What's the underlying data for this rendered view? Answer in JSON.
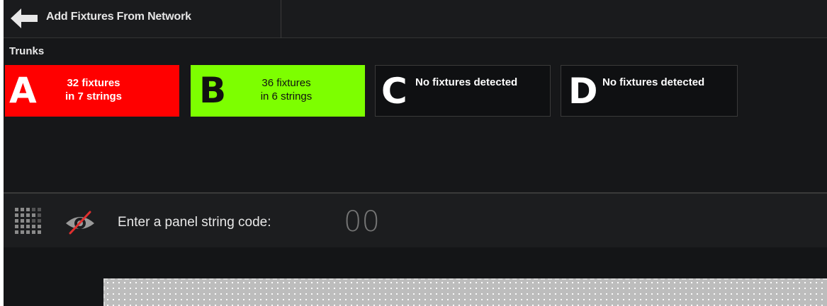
{
  "header": {
    "title": "Add Fixtures From Network",
    "back_icon": "arrow-left-icon"
  },
  "trunks": {
    "label": "Trunks",
    "items": [
      {
        "letter": "A",
        "line1": "32 fixtures",
        "line2": "in 7 strings",
        "color": "#ff0000"
      },
      {
        "letter": "B",
        "line1": "36 fixtures",
        "line2": "in 6 strings",
        "color": "#7dff00"
      },
      {
        "letter": "C",
        "line1": "No fixtures detected",
        "line2": "",
        "color": "#0f1012"
      },
      {
        "letter": "D",
        "line1": "No fixtures detected",
        "line2": "",
        "color": "#0f1012"
      }
    ]
  },
  "toolbar": {
    "grid_icon": "grid-icon",
    "visibility_icon": "eye-off-icon",
    "code_label": "Enter a panel string code:",
    "code_placeholder": "00"
  }
}
